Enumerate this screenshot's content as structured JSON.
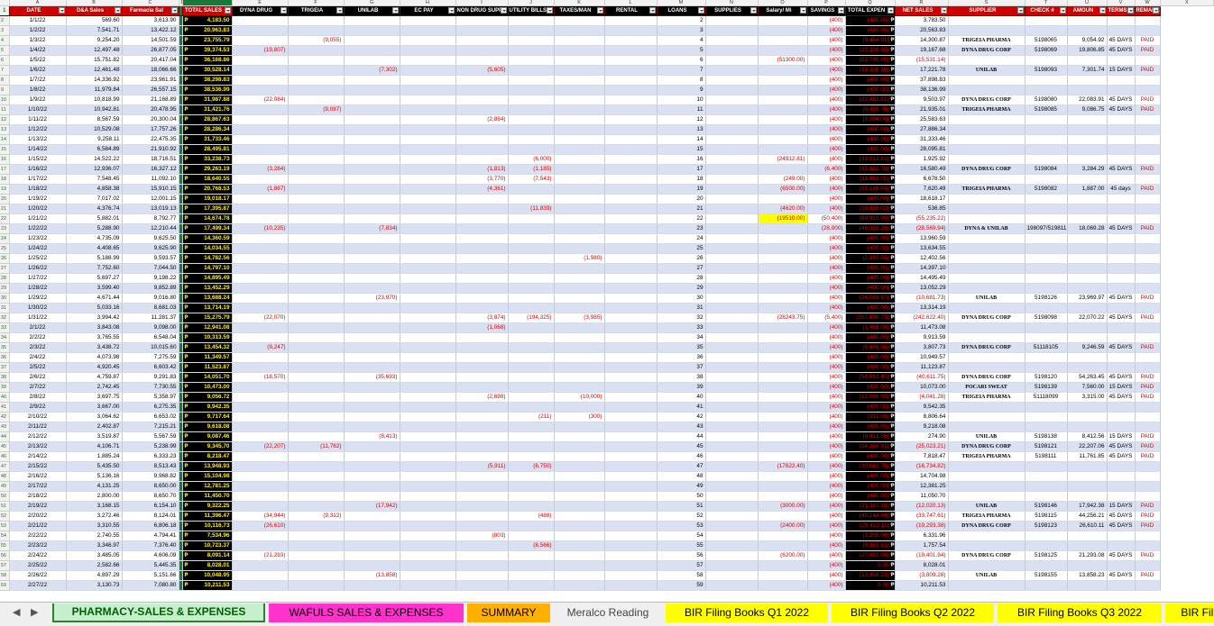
{
  "columns": [
    "A",
    "B",
    "C",
    "D",
    "E",
    "F",
    "G",
    "H",
    "I",
    "J",
    "K",
    "L",
    "M",
    "N",
    "O",
    "P",
    "Q",
    "R",
    "S",
    "T",
    "U",
    "V",
    "W",
    "X"
  ],
  "headers": [
    "DATE",
    "D&A Sales",
    "Farmacia Sal",
    "",
    "TOTAL SALES",
    "DYNA DRUG",
    "TRIGEIA",
    "UNILAB",
    "EC PAY",
    "NON DRUG SUPPL",
    "UTILITY BILLS",
    "TAXES/MAN",
    "RENTAL",
    "LOANS",
    "SUPPLIES",
    "Salary/ Mi",
    "SAVINGS",
    "TOTAL EXPEN",
    "NET SALES",
    "SUPPLIER",
    "CHECK #",
    "AMOUN",
    "TERMS",
    "REMARK"
  ],
  "rows": [
    {
      "n": 2,
      "a": "1/1/22",
      "b": "569.60",
      "c": "3,613.90",
      "e": "4,183.50",
      "r": "(400.00)",
      "q": "(400)",
      "s": "3,783.50"
    },
    {
      "n": 3,
      "a": "1/2/22",
      "b": "7,541.71",
      "c": "13,422.12",
      "e": "20,963.83",
      "r": "(400.00)",
      "q": "(400)",
      "s": "20,563.83"
    },
    {
      "n": 4,
      "a": "1/3/22",
      "b": "9,254.20",
      "c": "14,501.59",
      "e": "23,755.79",
      "g": "(9,055)",
      "r": "(9,454.91)",
      "q": "(400)",
      "s": "14,300.87",
      "t": "TRIGEIA PHARMA",
      "u": "5198065",
      "v": "9,054.92",
      "w": "45 DAYS",
      "x": "PAID"
    },
    {
      "n": 5,
      "a": "1/4/22",
      "b": "12,497.48",
      "c": "26,877.05",
      "e": "39,374.53",
      "f": "(19,807)",
      "r": "(20,206.85)",
      "q": "(400)",
      "s": "19,167.68",
      "t": "DYNA DRUG CORP",
      "u": "5198069",
      "v": "19,806.85",
      "w": "45 DAYS",
      "x": "PAID"
    },
    {
      "n": 6,
      "a": "1/5/22",
      "b": "15,751.82",
      "c": "20,417.04",
      "e": "36,168.86",
      "p": "(51300.00)",
      "r": "(51,700.00)",
      "q": "(400)",
      "s": "(15,531.14)"
    },
    {
      "n": 7,
      "a": "1/6/22",
      "b": "12,461.48",
      "c": "18,066.66",
      "e": "30,528.14",
      "h": "(7,302)",
      "j": "(5,605)",
      "r": "(13,306.36)",
      "q": "(400)",
      "s": "17,221.78",
      "t": "UNILAB",
      "u": "5198093",
      "v": "7,301.74",
      "w": "15 DAYS",
      "x": "PAID"
    },
    {
      "n": 8,
      "a": "1/7/22",
      "b": "14,336.92",
      "c": "23,961.91",
      "e": "38,298.83",
      "r": "(400.00)",
      "q": "(400)",
      "s": "37,898.83"
    },
    {
      "n": 9,
      "a": "1/8/22",
      "b": "11,979.84",
      "c": "26,557.15",
      "e": "38,536.99",
      "r": "(400.00)",
      "q": "(400)",
      "s": "38,136.99"
    },
    {
      "n": 10,
      "a": "1/9/22",
      "b": "10,818.99",
      "c": "21,168.89",
      "e": "31,987.88",
      "f": "(22,084)",
      "r": "(22,483.91)",
      "q": "(400)",
      "s": "9,503.97",
      "t": "DYNA DRUG CORP",
      "u": "5198080",
      "v": "22,083.91",
      "w": "45 DAYS",
      "x": "PAID"
    },
    {
      "n": 11,
      "a": "1/10/22",
      "b": "10,942.81",
      "c": "20,478.95",
      "e": "31,421.76",
      "g": "(9,087)",
      "r": "(9,486.75)",
      "q": "(400)",
      "s": "21,935.01",
      "t": "TRIGEIA PHARMA",
      "u": "5198085",
      "v": "9,086.75",
      "w": "45 DAYS",
      "x": "PAID"
    },
    {
      "n": 12,
      "a": "1/11/22",
      "b": "8,567.59",
      "c": "20,300.04",
      "e": "28,867.63",
      "j": "(2,884)",
      "r": "(3,284.00)",
      "q": "(400)",
      "s": "25,583.63"
    },
    {
      "n": 13,
      "a": "1/12/22",
      "b": "10,529.08",
      "c": "17,757.26",
      "e": "28,286.34",
      "r": "(400.00)",
      "q": "(400)",
      "s": "27,886.34"
    },
    {
      "n": 14,
      "a": "1/13/22",
      "b": "9,258.11",
      "c": "22,475.35",
      "e": "31,733.46",
      "r": "(400.00)",
      "q": "(400)",
      "s": "31,333.46"
    },
    {
      "n": 15,
      "a": "1/14/22",
      "b": "6,584.89",
      "c": "21,910.92",
      "e": "28,495.81",
      "r": "(400.00)",
      "q": "(400)",
      "s": "28,095.81"
    },
    {
      "n": 16,
      "a": "1/15/22",
      "b": "14,522.22",
      "c": "18,716.51",
      "e": "33,238.73",
      "k": "(6,000)",
      "p": "(24912.81)",
      "r": "(31,312.81)",
      "q": "(400)",
      "s": "1,925.92"
    },
    {
      "n": 17,
      "a": "1/16/22",
      "b": "12,936.07",
      "c": "16,327.12",
      "e": "29,263.19",
      "f": "(3,284)",
      "j": "(1,813)",
      "k": "(1,185)",
      "r": "(12,682.70)",
      "q": "(6,400)",
      "s": "16,580.49",
      "t": "DYNA DRUG CORP",
      "u": "5198084",
      "v": "3,284.29",
      "w": "45 DAYS",
      "x": "PAID"
    },
    {
      "n": 18,
      "a": "1/17/22",
      "b": "7,548.45",
      "c": "11,092.10",
      "e": "18,640.55",
      "j": "(3,770)",
      "k": "(7,543)",
      "p": "(249.00)",
      "r": "(11,962.05)",
      "q": "(400)",
      "s": "6,678.50"
    },
    {
      "n": 19,
      "a": "1/18/22",
      "b": "4,858.38",
      "c": "15,910.15",
      "e": "20,768.53",
      "f": "(1,887)",
      "j": "(4,361)",
      "p": "(6500.00)",
      "r": "(13,148.04)",
      "q": "(400)",
      "s": "7,620.49",
      "t": "TRIGEIA PHARMA",
      "u": "5198082",
      "v": "1,887.00",
      "w": "45 days",
      "x": "PAID"
    },
    {
      "n": 20,
      "a": "1/19/22",
      "b": "7,017.02",
      "c": "12,001.15",
      "e": "19,018.17",
      "r": "(400.00)",
      "q": "(400)",
      "s": "18,618.17"
    },
    {
      "n": 21,
      "a": "1/20/22",
      "b": "4,376.74",
      "c": "13,019.13",
      "e": "17,395.87",
      "k": "(11,839)",
      "p": "(4620.00)",
      "r": "(16,859.02)",
      "q": "(400)",
      "s": "536.85"
    },
    {
      "n": 22,
      "a": "1/21/22",
      "b": "5,882.01",
      "c": "8,792.77",
      "e": "14,674.78",
      "p": "(19510.00)",
      "phl": true,
      "r": "(69,910.00)",
      "q": "(50,400)",
      "s": "(55,235.22)"
    },
    {
      "n": 23,
      "a": "1/22/22",
      "b": "5,288.90",
      "c": "12,210.44",
      "e": "17,499.34",
      "f": "(10,235)",
      "h": "(7,834)",
      "r": "(46,069.28)",
      "q": "(28,000)",
      "s": "(28,569.94)",
      "t": "DYNA & UNILAB",
      "u": "198097/519811",
      "v": "18,069.28",
      "w": "45 DAYS",
      "x": "PAID"
    },
    {
      "n": 24,
      "a": "1/23/22",
      "b": "4,735.09",
      "c": "9,625.50",
      "e": "14,360.59",
      "r": "(400.00)",
      "q": "(400)",
      "s": "13,960.59"
    },
    {
      "n": 25,
      "a": "1/24/22",
      "b": "4,408.65",
      "c": "9,625.90",
      "e": "14,034.55",
      "r": "(400.00)",
      "q": "(400)",
      "s": "13,634.55"
    },
    {
      "n": 26,
      "a": "1/25/22",
      "b": "5,188.99",
      "c": "9,593.57",
      "e": "14,782.56",
      "l": "(1,980)",
      "r": "(2,380.00)",
      "q": "(400)",
      "s": "12,402.56"
    },
    {
      "n": 27,
      "a": "1/26/22",
      "b": "7,752.60",
      "c": "7,044.50",
      "e": "14,797.10",
      "r": "(400.00)",
      "q": "(400)",
      "s": "14,397.10"
    },
    {
      "n": 28,
      "a": "1/27/22",
      "b": "5,697.27",
      "c": "9,198.22",
      "e": "14,895.49",
      "r": "(400.00)",
      "q": "(400)",
      "s": "14,495.49"
    },
    {
      "n": 29,
      "a": "1/28/22",
      "b": "3,599.40",
      "c": "9,852.89",
      "e": "13,452.29",
      "r": "(400.00)",
      "q": "(400)",
      "s": "13,052.29"
    },
    {
      "n": 30,
      "a": "1/29/22",
      "b": "4,671.44",
      "c": "9,016.80",
      "e": "13,688.24",
      "h": "(23,970)",
      "r": "(24,369.97)",
      "q": "(400)",
      "s": "(10,681.73)",
      "t": "UNILAB",
      "u": "5198126",
      "v": "23,969.97",
      "w": "45 DAYS",
      "x": "PAID"
    },
    {
      "n": 31,
      "a": "1/30/22",
      "b": "5,033.16",
      "c": "8,681.03",
      "e": "13,714.19",
      "r": "(400.00)",
      "q": "(400)",
      "s": "13,314.19"
    },
    {
      "n": 32,
      "a": "1/31/22",
      "b": "3,994.42",
      "c": "11,281.37",
      "e": "15,275.79",
      "f": "(22,070)",
      "j": "(3,874)",
      "k": "(194,325)",
      "l": "(3,985)",
      "p": "(28243.75)",
      "r": "(257,898.73)",
      "q": "(5,400)",
      "s": "(242,622.40)",
      "t": "DYNA DRUG CORP",
      "u": "5198098",
      "v": "22,070.22",
      "w": "45 DAYS",
      "x": "PAID"
    },
    {
      "n": 33,
      "a": "2/1/22",
      "b": "3,843.08",
      "c": "9,098.00",
      "e": "12,941.08",
      "j": "(1,068)",
      "r": "(1,468.00)",
      "q": "(400)",
      "s": "11,473.08"
    },
    {
      "n": 34,
      "a": "2/2/22",
      "b": "3,765.55",
      "c": "6,548.04",
      "e": "10,313.59",
      "r": "(400.00)",
      "q": "(400)",
      "s": "9,913.59"
    },
    {
      "n": 35,
      "a": "2/3/22",
      "b": "3,438.72",
      "c": "10,015.60",
      "e": "13,454.32",
      "f": "(9,247)",
      "r": "(9,646.59)",
      "q": "(400)",
      "s": "3,807.73",
      "t": "DYNA DRUG CORP",
      "u": "51118105",
      "v": "9,246.59",
      "w": "45 DAYS",
      "x": "PAID"
    },
    {
      "n": 36,
      "a": "2/4/22",
      "b": "4,073.98",
      "c": "7,275.59",
      "e": "11,349.57",
      "r": "(400.00)",
      "q": "(400)",
      "s": "10,949.57"
    },
    {
      "n": 37,
      "a": "2/5/22",
      "b": "4,920.45",
      "c": "6,603.42",
      "e": "11,523.87",
      "r": "(400.00)",
      "q": "(400)",
      "s": "11,123.87"
    },
    {
      "n": 38,
      "a": "2/6/22",
      "b": "4,759.87",
      "c": "9,291.83",
      "e": "14,051.70",
      "f": "(18,570)",
      "h": "(35,693)",
      "r": "(54,663.45)",
      "q": "(400)",
      "s": "(40,611.75)",
      "t": "DYNA DRUG CORP",
      "u": "5198120",
      "v": "54,263.45",
      "w": "45 DAYS",
      "x": "PAID"
    },
    {
      "n": 39,
      "a": "2/7/22",
      "b": "2,742.45",
      "c": "7,730.55",
      "e": "10,473.00",
      "r": "(400.00)",
      "q": "(400)",
      "s": "10,073.00",
      "t": "POCARI SWEAT",
      "u": "5198139",
      "v": "7,560.00",
      "w": "15 DAYS",
      "x": "PAID"
    },
    {
      "n": 40,
      "a": "2/8/22",
      "b": "3,697.75",
      "c": "5,358.97",
      "e": "9,056.72",
      "j": "(2,698)",
      "l": "(10,000)",
      "r": "(13,098.00)",
      "q": "(400)",
      "s": "(4,041.28)",
      "t": "TRIGEIA PHARMA",
      "u": "51118099",
      "v": "3,315.00",
      "w": "45 DAYS",
      "x": "PAID"
    },
    {
      "n": 41,
      "a": "2/9/22",
      "b": "3,667.00",
      "c": "6,275.35",
      "e": "9,942.35",
      "r": "(400.00)",
      "q": "(400)",
      "s": "9,542.35"
    },
    {
      "n": 42,
      "a": "2/10/22",
      "b": "3,064.62",
      "c": "6,653.02",
      "e": "9,717.64",
      "k": "(211)",
      "l": "(300)",
      "r": "(911.00)",
      "q": "(400)",
      "s": "8,806.64"
    },
    {
      "n": 43,
      "a": "2/11/22",
      "b": "2,402.87",
      "c": "7,215.21",
      "e": "9,618.08",
      "r": "(400.00)",
      "q": "(400)",
      "s": "9,218.08"
    },
    {
      "n": 44,
      "a": "2/12/22",
      "b": "3,519.87",
      "c": "5,567.59",
      "e": "9,087.46",
      "h": "(8,413)",
      "r": "(8,812.56)",
      "q": "(400)",
      "s": "274.90",
      "t": "UNILAB",
      "u": "5198138",
      "v": "8,412.56",
      "w": "15 DAYS",
      "x": "PAID"
    },
    {
      "n": 45,
      "a": "2/13/22",
      "b": "4,106.71",
      "c": "5,238.99",
      "e": "9,345.70",
      "f": "(22,207)",
      "g": "(11,762)",
      "r": "(34,368.91)",
      "q": "(400)",
      "s": "(25,023.21)",
      "t": "DYNA DRUG CORP",
      "u": "5198121",
      "v": "22,207.06",
      "w": "45 DAYS",
      "x": "PAID"
    },
    {
      "n": 46,
      "a": "2/14/22",
      "b": "1,885.24",
      "c": "6,333.23",
      "e": "8,218.47",
      "r": "(400.00)",
      "q": "(400)",
      "s": "7,818.47",
      "t": "TRIGEIA PHARMA",
      "u": "5198111",
      "v": "11,761.85",
      "w": "45 DAYS",
      "x": "PAID"
    },
    {
      "n": 47,
      "a": "2/15/22",
      "b": "5,435.50",
      "c": "8,513.43",
      "e": "13,948.93",
      "j": "(5,911)",
      "k": "(6,750)",
      "p": "(17622.40)",
      "r": "(30,683.75)",
      "q": "(400)",
      "s": "(16,734.82)"
    },
    {
      "n": 48,
      "a": "2/16/22",
      "b": "5,136.16",
      "c": "9,968.82",
      "e": "15,104.98",
      "r": "(400.00)",
      "q": "(400)",
      "s": "14,704.98"
    },
    {
      "n": 49,
      "a": "2/17/22",
      "b": "4,131.25",
      "c": "8,650.00",
      "e": "12,781.25",
      "r": "(400.00)",
      "q": "(400)",
      "s": "12,381.25"
    },
    {
      "n": 50,
      "a": "2/18/22",
      "b": "2,800.00",
      "c": "8,650.70",
      "e": "11,450.70",
      "r": "(400.00)",
      "q": "(400)",
      "s": "11,050.70"
    },
    {
      "n": 51,
      "a": "2/19/22",
      "b": "3,168.15",
      "c": "6,154.10",
      "e": "9,322.25",
      "h": "(17,942)",
      "p": "(3000.00)",
      "r": "(21,342.38)",
      "q": "(400)",
      "s": "(12,020.13)",
      "t": "UNILAB",
      "u": "5198146",
      "v": "17,942.38",
      "w": "15 DAYS",
      "x": "PAID"
    },
    {
      "n": 52,
      "a": "2/20/22",
      "b": "3,272.46",
      "c": "8,124.01",
      "e": "11,396.47",
      "f": "(34,944)",
      "g": "(9,312)",
      "k": "(488)",
      "r": "(45,144.08)",
      "q": "(400)",
      "s": "(33,747.61)",
      "t": "TRIGEIA PHARMA",
      "u": "5198115",
      "v": "44,256.21",
      "w": "45 DAYS",
      "x": "PAID"
    },
    {
      "n": 53,
      "a": "2/21/22",
      "b": "3,310.55",
      "c": "6,806.18",
      "e": "10,116.73",
      "f": "(26,610)",
      "p": "(2400.00)",
      "r": "(29,410.11)",
      "q": "(400)",
      "s": "(19,293.38)",
      "t": "DYNA DRUG CORP",
      "u": "5198123",
      "v": "26,610.11",
      "w": "45 DAYS",
      "x": "PAID"
    },
    {
      "n": 54,
      "a": "2/22/22",
      "b": "2,740.55",
      "c": "4,794.41",
      "e": "7,534.96",
      "j": "(803)",
      "r": "(1,203.00)",
      "q": "(400)",
      "s": "6,331.96"
    },
    {
      "n": 55,
      "a": "2/23/22",
      "b": "3,346.97",
      "c": "7,376.40",
      "e": "10,723.37",
      "k": "(8,566)",
      "r": "(8,965.83)",
      "q": "(400)",
      "s": "1,757.54"
    },
    {
      "n": 56,
      "a": "2/24/22",
      "b": "3,485.05",
      "c": "4,606.09",
      "e": "8,091.14",
      "f": "(21,293)",
      "p": "(6200.00)",
      "r": "(27,493.08)",
      "q": "(400)",
      "s": "(19,401.94)",
      "t": "DYNA DRUG CORP",
      "u": "5198125",
      "v": "21,293.08",
      "w": "45 DAYS",
      "x": "PAID"
    },
    {
      "n": 57,
      "a": "2/25/22",
      "b": "2,582.66",
      "c": "5,445.35",
      "e": "8,028.01",
      "r": "0.00",
      "q": "(400)",
      "s": "8,028.01"
    },
    {
      "n": 58,
      "a": "2/26/22",
      "b": "4,897.29",
      "c": "5,151.66",
      "e": "10,048.95",
      "h": "(13,858)",
      "r": "(13,858.23)",
      "q": "(400)",
      "s": "(3,809.28)",
      "t": "UNILAB",
      "u": "5198155",
      "v": "13,858.23",
      "w": "45 DAYS",
      "x": "PAID"
    },
    {
      "n": 59,
      "a": "2/27/22",
      "b": "3,130.73",
      "c": "7,080.80",
      "e": "10,211.53",
      "r": "0.00",
      "q": "(400)",
      "s": "10,211.53"
    }
  ],
  "tabs": [
    {
      "label": "PHARMACY-SALES & EXPENSES",
      "bg": "#c6efce",
      "fg": "#006100",
      "active": true
    },
    {
      "label": "WAFULS SALES & EXPENSES",
      "bg": "#ff33cc",
      "fg": "#000000",
      "active": false
    },
    {
      "label": "SUMMARY",
      "bg": "#ffb000",
      "fg": "#000000",
      "active": false
    },
    {
      "label": "Meralco Reading",
      "bg": "#f0f0f0",
      "fg": "#444444",
      "active": false
    },
    {
      "label": "BIR Filing Books Q1 2022",
      "bg": "#ffff00",
      "fg": "#000000",
      "active": false
    },
    {
      "label": "BIR Filing Books Q2 2022",
      "bg": "#ffff00",
      "fg": "#000000",
      "active": false
    },
    {
      "label": "BIR Filing Books Q3 2022",
      "bg": "#ffff00",
      "fg": "#000000",
      "active": false
    },
    {
      "label": "BIR Filin",
      "bg": "#ffff00",
      "fg": "#000000",
      "active": false
    }
  ],
  "nav": {
    "prev": "◀",
    "next": "▶"
  },
  "icons": {
    "tab_prev": "triangle-left-icon",
    "tab_next": "triangle-right-icon",
    "filter": "filter-dropdown-icon"
  }
}
